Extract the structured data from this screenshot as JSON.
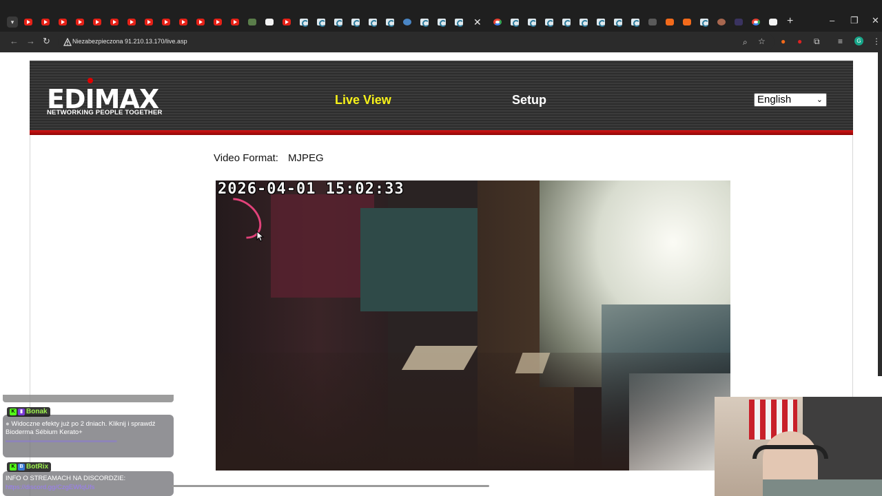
{
  "browser": {
    "tabs": [
      {
        "icon": "youtube-icon"
      },
      {
        "icon": "youtube-icon"
      },
      {
        "icon": "youtube-icon"
      },
      {
        "icon": "youtube-icon"
      },
      {
        "icon": "youtube-icon"
      },
      {
        "icon": "youtube-icon"
      },
      {
        "icon": "youtube-icon"
      },
      {
        "icon": "youtube-icon"
      },
      {
        "icon": "youtube-icon"
      },
      {
        "icon": "youtube-icon"
      },
      {
        "icon": "youtube-icon"
      },
      {
        "icon": "youtube-icon"
      },
      {
        "icon": "youtube-icon"
      },
      {
        "icon": "map-icon"
      },
      {
        "icon": "page-icon"
      },
      {
        "icon": "youtube-icon"
      },
      {
        "icon": "edimax-icon"
      },
      {
        "icon": "edimax-icon"
      },
      {
        "icon": "edimax-icon"
      },
      {
        "icon": "edimax-icon"
      },
      {
        "icon": "edimax-icon"
      },
      {
        "icon": "edimax-icon"
      },
      {
        "icon": "globe-icon"
      },
      {
        "icon": "edimax-icon"
      },
      {
        "icon": "edimax-icon"
      },
      {
        "icon": "edimax-icon"
      },
      {
        "icon": "close-icon",
        "active": true
      },
      {
        "icon": "google-icon"
      },
      {
        "icon": "edimax-icon"
      },
      {
        "icon": "edimax-icon"
      },
      {
        "icon": "edimax-icon"
      },
      {
        "icon": "edimax-icon"
      },
      {
        "icon": "edimax-icon"
      },
      {
        "icon": "edimax-icon"
      },
      {
        "icon": "edimax-icon"
      },
      {
        "icon": "edimax-icon"
      },
      {
        "icon": "dark-icon"
      },
      {
        "icon": "orange-icon"
      },
      {
        "icon": "orange-icon"
      },
      {
        "icon": "edimax-icon"
      },
      {
        "icon": "avatar-icon"
      },
      {
        "icon": "purple-icon"
      },
      {
        "icon": "google-icon"
      },
      {
        "icon": "clock-icon"
      }
    ],
    "new_tab": "+",
    "security_label": "Niezabezpieczona",
    "url": "91.210.13.170/live.asp",
    "profile_initial": "G"
  },
  "page": {
    "logo_text": "EDIMAX",
    "tagline": "NETWORKING PEOPLE TOGETHER",
    "nav": {
      "live_view": "Live View",
      "setup": "Setup"
    },
    "language": {
      "selected": "English"
    },
    "video_format_label": "Video Format:",
    "video_format_value": "MJPEG",
    "timestamp": "2026-04-01 15:02:33"
  },
  "overlay": {
    "chat": [
      {
        "user": "Bonak",
        "text": "Widoczne efekty już po 2 dniach. Kliknij i sprawdź Bioderma Sébium Kerato+"
      },
      {
        "user": "BotRix",
        "text": "INFO O STREAMACH NA DISCORDZIE:",
        "link": "https://discord.gg/CzgEWfqUfs"
      }
    ]
  },
  "colors": {
    "active_nav": "#f7f21a",
    "header_red": "#d21414",
    "chat_name": "#9cf24d"
  }
}
